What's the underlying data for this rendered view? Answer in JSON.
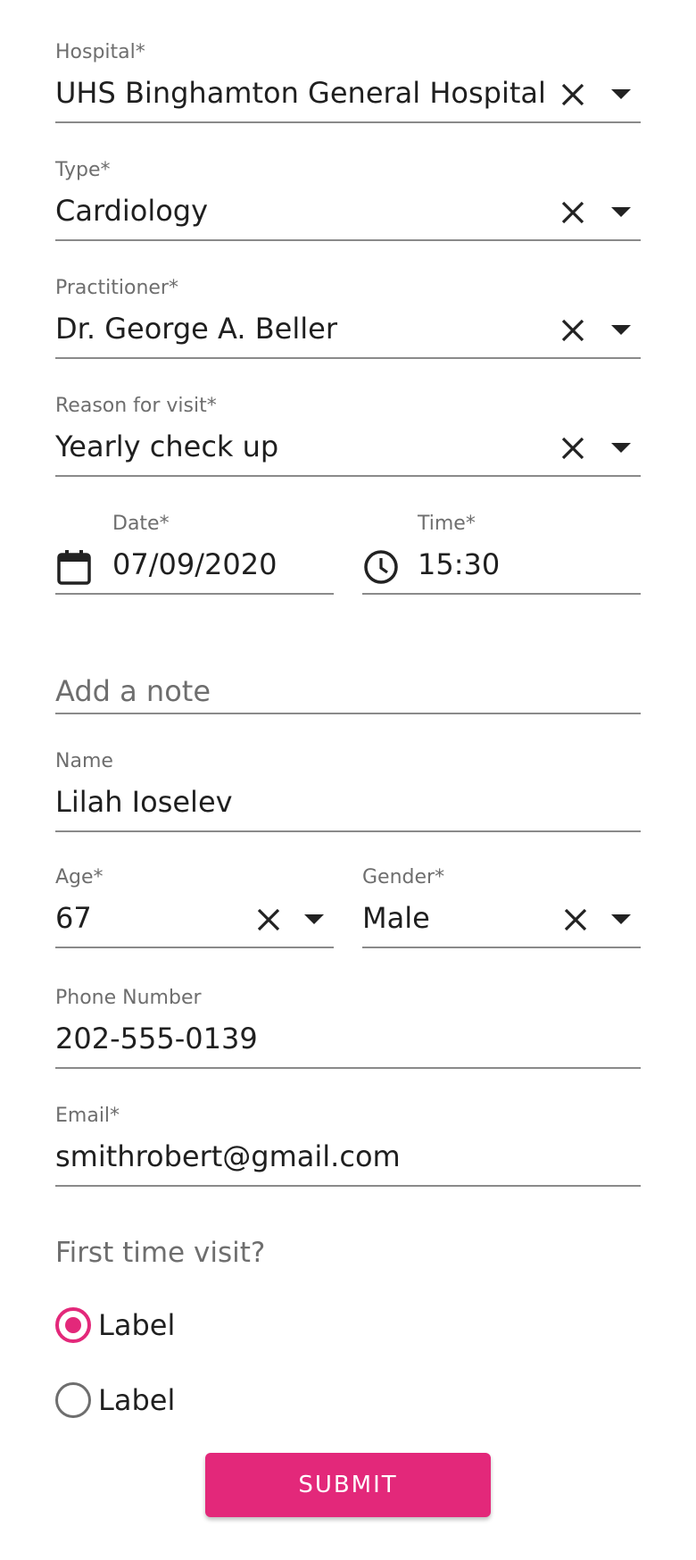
{
  "form": {
    "hospital": {
      "label": "Hospital*",
      "value": "UHS Binghamton General Hospital"
    },
    "type": {
      "label": "Type*",
      "value": "Cardiology"
    },
    "practitioner": {
      "label": "Practitioner*",
      "value": "Dr. George A. Beller"
    },
    "reason": {
      "label": "Reason for visit*",
      "value": "Yearly check up"
    },
    "date": {
      "label": "Date*",
      "value": "07/09/2020"
    },
    "time": {
      "label": "Time*",
      "value": "15:30"
    },
    "note": {
      "placeholder": "Add a note"
    },
    "name": {
      "label": "Name",
      "value": "Lilah Ioselev"
    },
    "age": {
      "label": "Age*",
      "value": "67"
    },
    "gender": {
      "label": "Gender*",
      "value": "Male"
    },
    "phone": {
      "label": "Phone Number",
      "value": "202-555-0139"
    },
    "email": {
      "label": "Email*",
      "value": "smithrobert@gmail.com"
    },
    "first_visit": {
      "question": "First time visit?",
      "options": [
        {
          "label": "Label",
          "selected": true
        },
        {
          "label": "Label",
          "selected": false
        }
      ]
    },
    "submit_label": "SUBMIT"
  },
  "colors": {
    "accent": "#e3287a",
    "label": "#6e6e6e",
    "text": "#1f1f1f",
    "underline": "#8a8a8a"
  },
  "icons": [
    "close-icon",
    "caret-down-icon",
    "calendar-icon",
    "clock-icon"
  ]
}
